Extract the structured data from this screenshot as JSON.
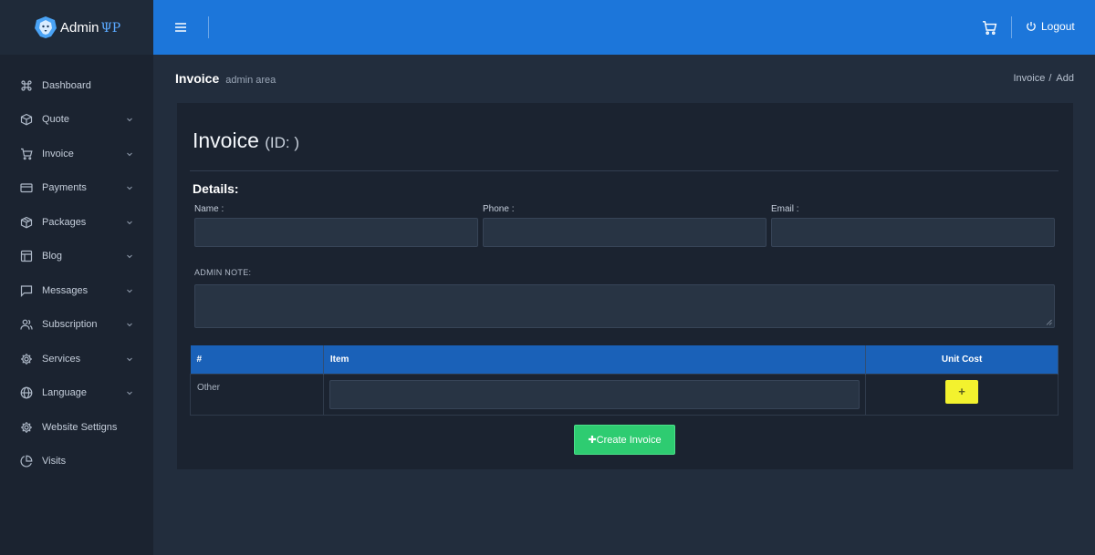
{
  "brand": {
    "name": "Admin",
    "accent": "ΨΡ"
  },
  "sidebar": {
    "items": [
      {
        "label": "Dashboard",
        "icon": "command-icon",
        "has_submenu": false
      },
      {
        "label": "Quote",
        "icon": "box-icon",
        "has_submenu": true
      },
      {
        "label": "Invoice",
        "icon": "cart-icon",
        "has_submenu": true
      },
      {
        "label": "Payments",
        "icon": "credit-card-icon",
        "has_submenu": true
      },
      {
        "label": "Packages",
        "icon": "package-icon",
        "has_submenu": true
      },
      {
        "label": "Blog",
        "icon": "layout-icon",
        "has_submenu": true
      },
      {
        "label": "Messages",
        "icon": "message-icon",
        "has_submenu": true
      },
      {
        "label": "Subscription",
        "icon": "users-icon",
        "has_submenu": true
      },
      {
        "label": "Services",
        "icon": "gear-icon",
        "has_submenu": true
      },
      {
        "label": "Language",
        "icon": "globe-icon",
        "has_submenu": true
      },
      {
        "label": "Website Settigns",
        "icon": "settings-icon",
        "has_submenu": false
      },
      {
        "label": "Visits",
        "icon": "pie-chart-icon",
        "has_submenu": false
      }
    ]
  },
  "topbar": {
    "logout_label": "Logout"
  },
  "header": {
    "title": "Invoice",
    "subtitle": "admin area"
  },
  "breadcrumb": {
    "first": "Invoice",
    "separator": "/",
    "current": "Add"
  },
  "card": {
    "title": "Invoice",
    "id_label": "(ID: )",
    "details_heading": "Details:",
    "fields": {
      "name_label": "Name :",
      "phone_label": "Phone :",
      "email_label": "Email :"
    },
    "note_label": "ADMIN NOTE:"
  },
  "table": {
    "headers": {
      "num": "#",
      "item": "Item",
      "unit_cost": "Unit Cost"
    },
    "row": {
      "num": "Other",
      "add_label": "+"
    }
  },
  "create_button": "✚Create Invoice",
  "colors": {
    "topbar": "#1c76da",
    "sidebar": "#1b2330",
    "table_header": "#1a61b8",
    "add_button": "#f3f22e",
    "create_button": "#2ecc71"
  }
}
